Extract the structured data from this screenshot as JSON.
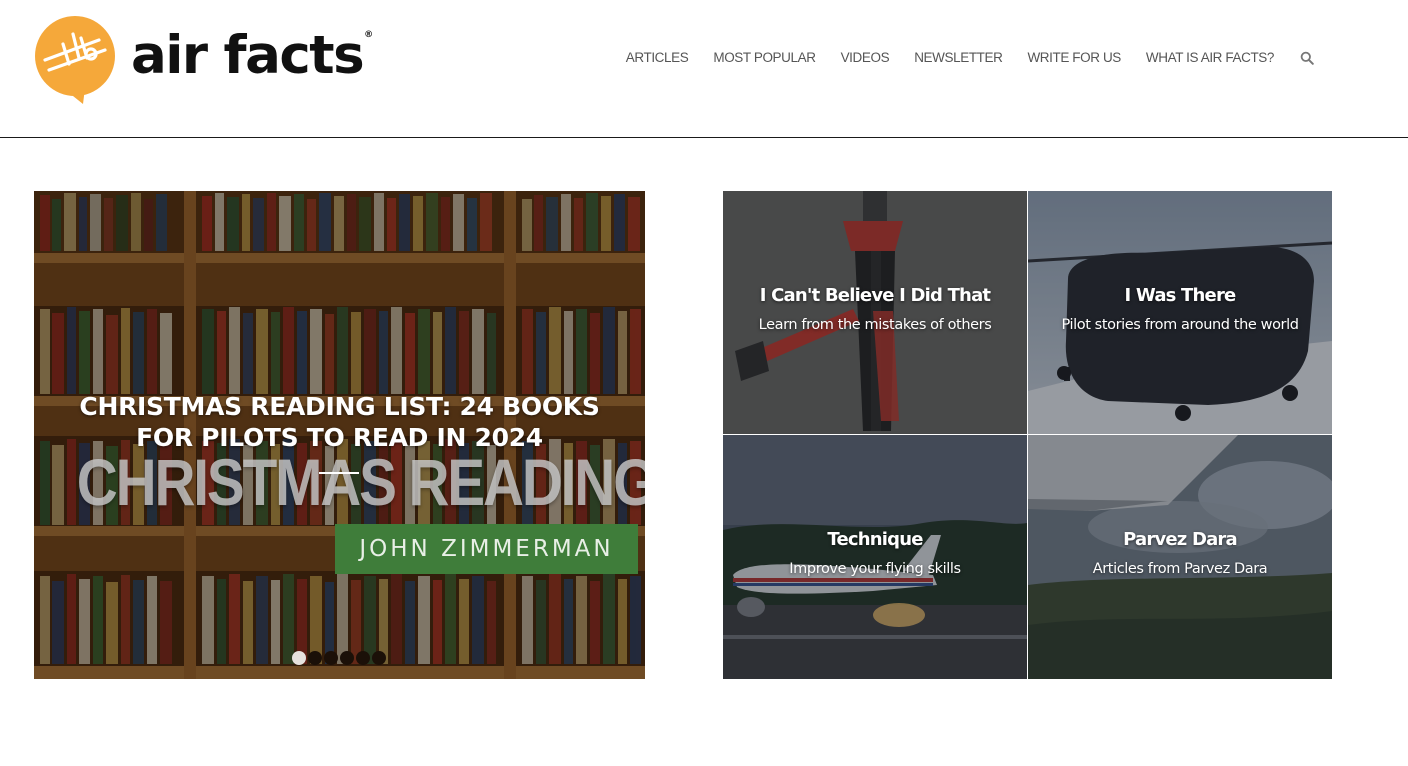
{
  "header": {
    "brand": "air facts",
    "registered_mark": "®",
    "nav": [
      "ARTICLES",
      "MOST POPULAR",
      "VIDEOS",
      "NEWSLETTER",
      "WRITE FOR US",
      "WHAT IS AIR FACTS?"
    ],
    "search_icon": "search-icon",
    "logo_color": "#f5a83a"
  },
  "hero": {
    "title": "CHRISTMAS READING LIST: 24 BOOKS FOR PILOTS TO READ IN 2024",
    "image_headline": "CHRISTMAS READING LIST",
    "image_byline": "JOHN ZIMMERMAN",
    "slides_count": 6,
    "active_slide": 1
  },
  "tiles": [
    {
      "title": "I Can't Believe I Did That",
      "subtitle": "Learn from the mistakes of others"
    },
    {
      "title": "I Was There",
      "subtitle": "Pilot stories from around the world"
    },
    {
      "title": "Technique",
      "subtitle": "Improve your flying skills"
    },
    {
      "title": "Parvez Dara",
      "subtitle": "Articles from Parvez Dara"
    }
  ]
}
